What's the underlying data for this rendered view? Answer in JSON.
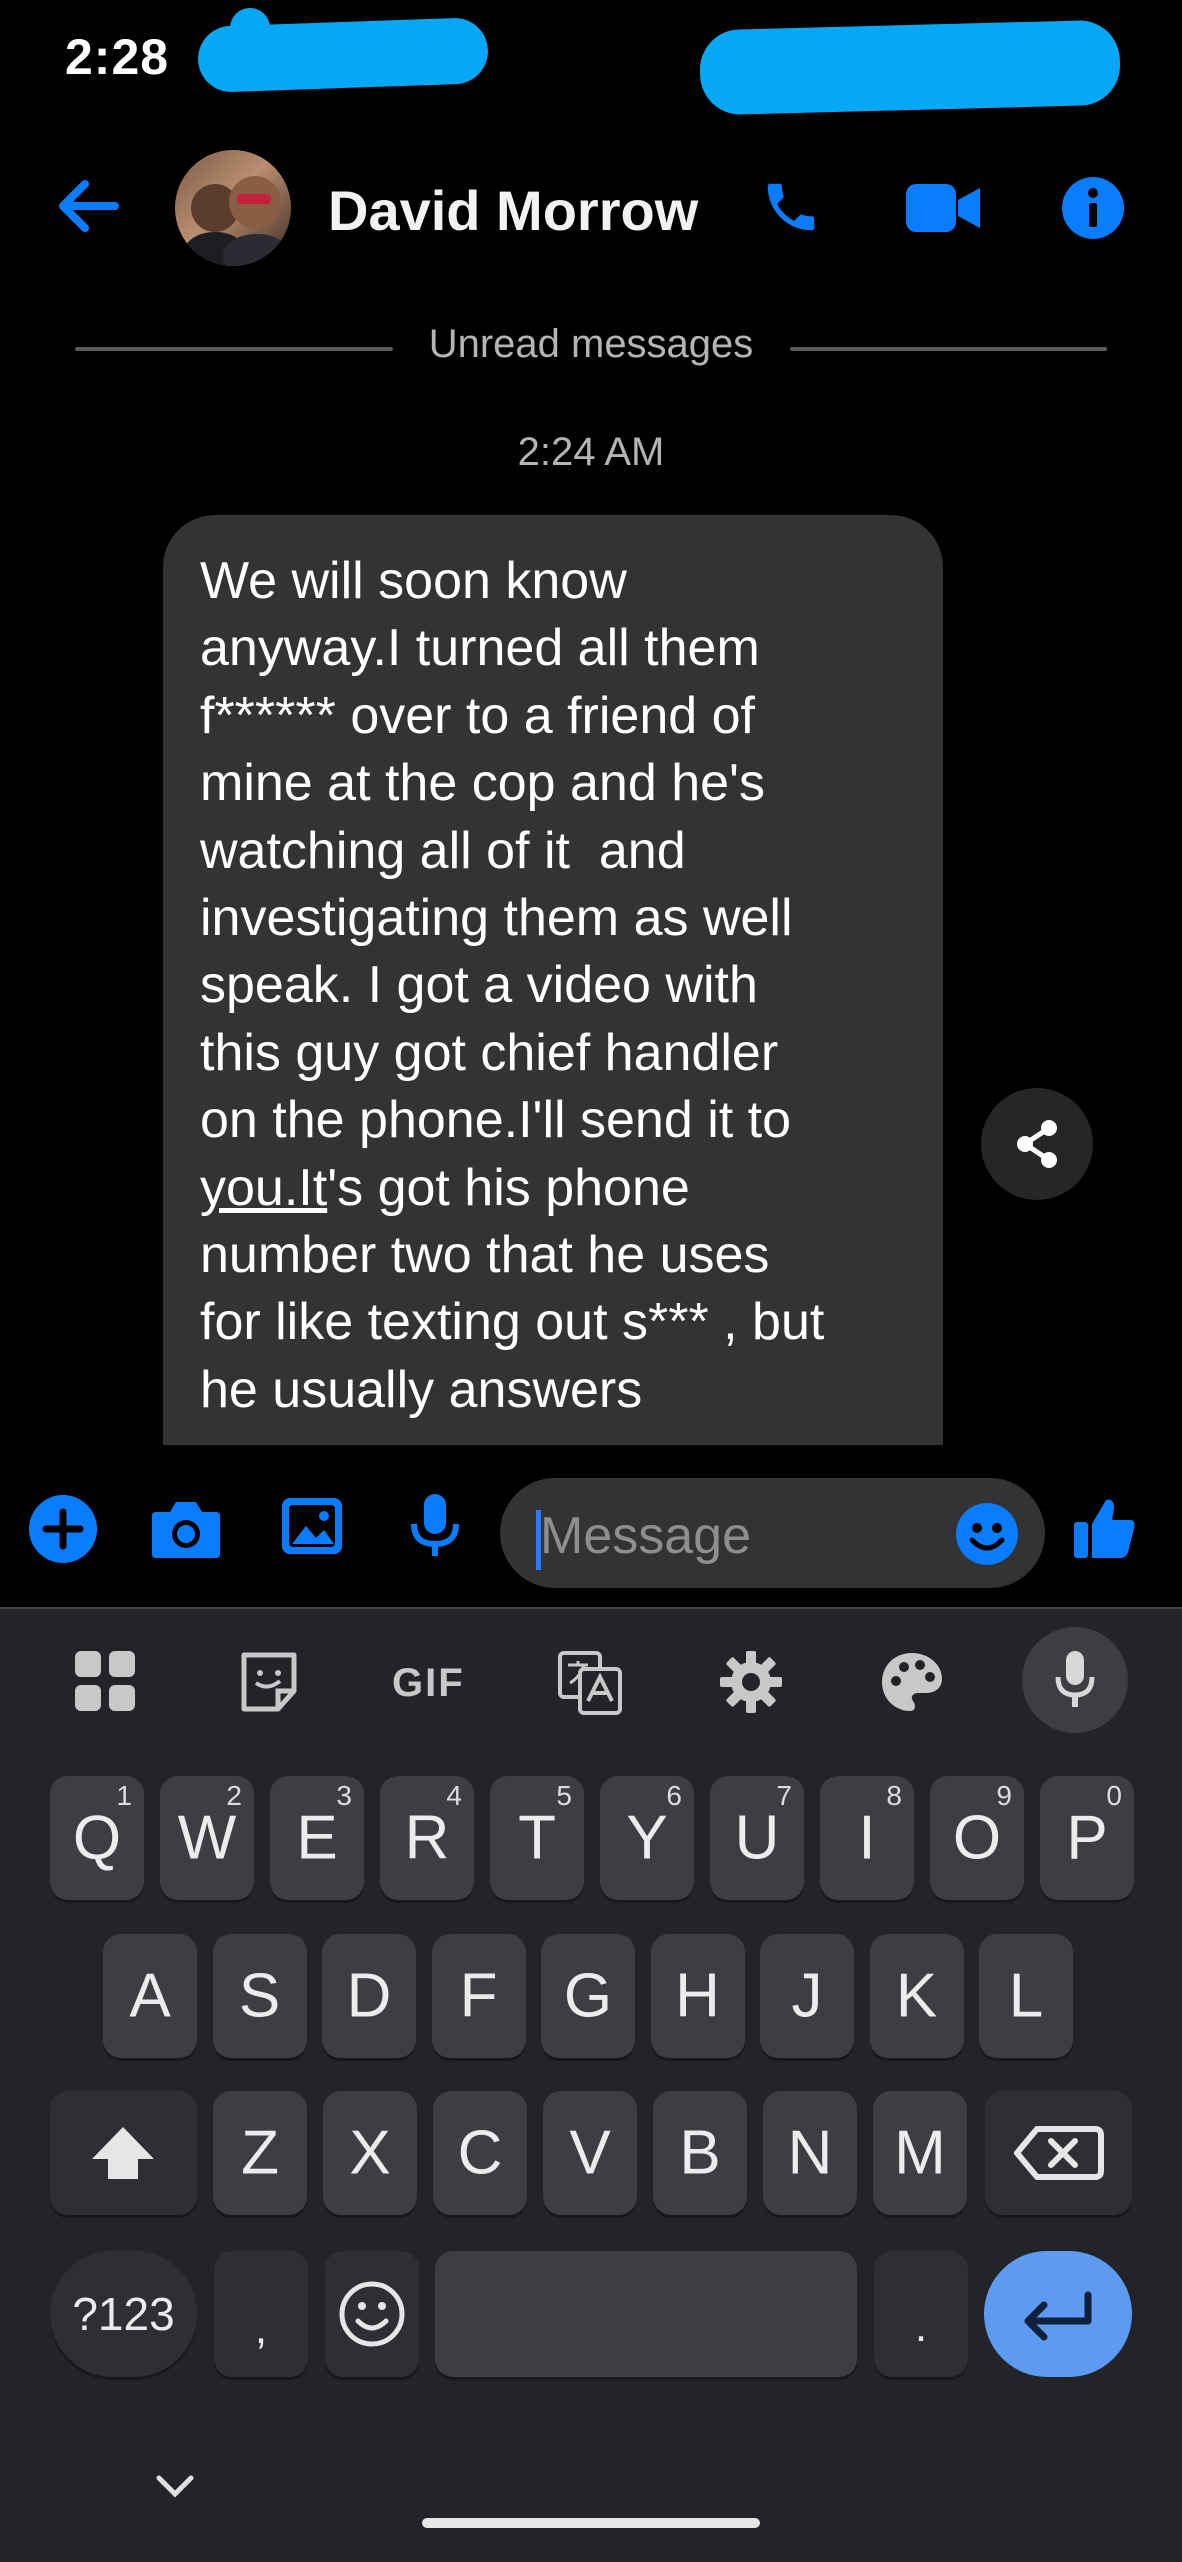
{
  "status_bar": {
    "time": "2:28"
  },
  "header": {
    "contact_name": "David Morrow"
  },
  "thread": {
    "divider_label": "Unread messages",
    "timestamp": "2:24 AM",
    "message_lines": [
      "We will soon know",
      "anyway.I turned all them",
      "f****** over to a friend of",
      "mine at the cop and he's",
      "watching all of it  and",
      "investigating them as well",
      "speak. I got a video with",
      "this guy got chief handler",
      "on the phone.I'll send it to",
      "you.It",
      "'s got his phone",
      "number two that he uses",
      "for like texting out s*** , but",
      "he usually answers"
    ]
  },
  "composer": {
    "placeholder": "Message"
  },
  "keyboard": {
    "toolbar": {
      "gif": "GIF"
    },
    "row1": [
      {
        "k": "Q",
        "n": "1"
      },
      {
        "k": "W",
        "n": "2"
      },
      {
        "k": "E",
        "n": "3"
      },
      {
        "k": "R",
        "n": "4"
      },
      {
        "k": "T",
        "n": "5"
      },
      {
        "k": "Y",
        "n": "6"
      },
      {
        "k": "U",
        "n": "7"
      },
      {
        "k": "I",
        "n": "8"
      },
      {
        "k": "O",
        "n": "9"
      },
      {
        "k": "P",
        "n": "0"
      }
    ],
    "row2": [
      "A",
      "S",
      "D",
      "F",
      "G",
      "H",
      "J",
      "K",
      "L"
    ],
    "row3": [
      "Z",
      "X",
      "C",
      "V",
      "B",
      "N",
      "M"
    ],
    "symbols_key": "?123",
    "comma_key": ",",
    "period_key": "."
  },
  "colors": {
    "accent": "#0a7cff",
    "enter_key": "#5d9bf0",
    "redaction": "#06a8f5"
  }
}
